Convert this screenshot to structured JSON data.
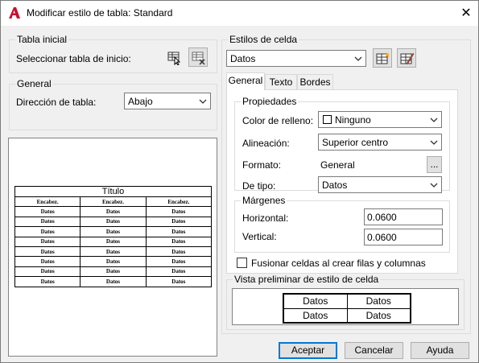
{
  "window": {
    "title": "Modificar estilo de tabla: Standard",
    "close_glyph": "✕"
  },
  "tabla_inicial": {
    "group_label": "Tabla inicial",
    "select_label": "Seleccionar tabla de inicio:"
  },
  "general": {
    "group_label": "General",
    "direction_label": "Dirección de tabla:",
    "direction_value": "Abajo"
  },
  "preview": {
    "title": "Título",
    "headers": [
      "Encabez.",
      "Encabez.",
      "Encabez."
    ],
    "rows": [
      [
        "Datos",
        "Datos",
        "Datos"
      ],
      [
        "Datos",
        "Datos",
        "Datos"
      ],
      [
        "Datos",
        "Datos",
        "Datos"
      ],
      [
        "Datos",
        "Datos",
        "Datos"
      ],
      [
        "Datos",
        "Datos",
        "Datos"
      ],
      [
        "Datos",
        "Datos",
        "Datos"
      ],
      [
        "Datos",
        "Datos",
        "Datos"
      ],
      [
        "Datos",
        "Datos",
        "Datos"
      ]
    ]
  },
  "cell_styles": {
    "group_label": "Estilos de celda",
    "selected": "Datos",
    "tabs": [
      "General",
      "Texto",
      "Bordes"
    ],
    "active_tab": "General"
  },
  "properties": {
    "group_label": "Propiedades",
    "fill_label": "Color de relleno:",
    "fill_value": "Ninguno",
    "align_label": "Alineación:",
    "align_value": "Superior centro",
    "format_label": "Formato:",
    "format_value": "General",
    "format_button": "...",
    "type_label": "De tipo:",
    "type_value": "Datos"
  },
  "margins": {
    "group_label": "Márgenes",
    "horizontal_label": "Horizontal:",
    "horizontal_value": "0.0600",
    "vertical_label": "Vertical:",
    "vertical_value": "0.0600"
  },
  "merge": {
    "label": "Fusionar celdas al crear filas y columnas",
    "checked": false
  },
  "cell_preview": {
    "group_label": "Vista preliminar de estilo de celda",
    "cells": [
      [
        "Datos",
        "Datos"
      ],
      [
        "Datos",
        "Datos"
      ]
    ]
  },
  "buttons": {
    "accept": "Aceptar",
    "cancel": "Cancelar",
    "help": "Ayuda"
  },
  "colors": {
    "accent": "#0078d7",
    "app_icon": "#c8102e",
    "dialog_bg": "#f0f0f0"
  }
}
